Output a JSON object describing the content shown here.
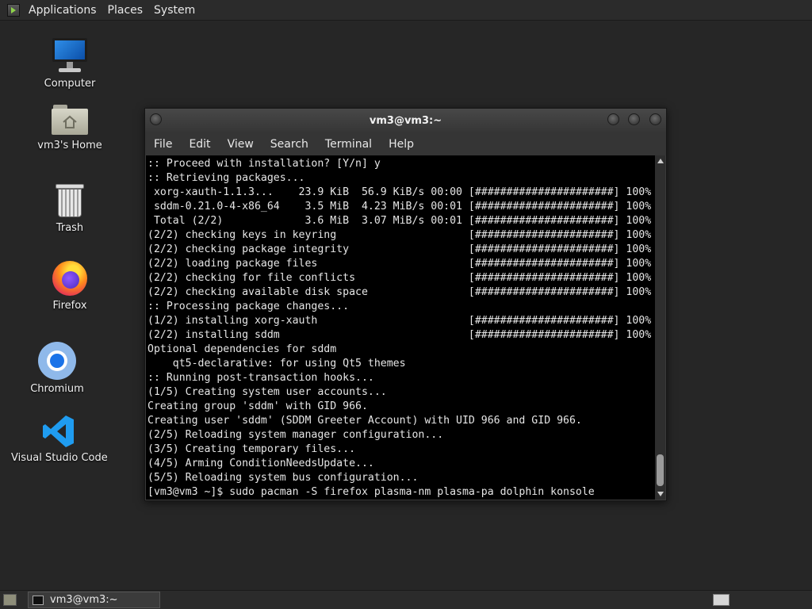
{
  "top_panel": {
    "menus": [
      "Applications",
      "Places",
      "System"
    ]
  },
  "desktop_icons": {
    "computer": "Computer",
    "home": "vm3's Home",
    "trash": "Trash",
    "firefox": "Firefox",
    "chromium": "Chromium",
    "vscode": "Visual Studio Code"
  },
  "terminal": {
    "title": "vm3@vm3:~",
    "menu": [
      "File",
      "Edit",
      "View",
      "Search",
      "Terminal",
      "Help"
    ],
    "lines": [
      ":: Proceed with installation? [Y/n] y",
      ":: Retrieving packages...",
      " xorg-xauth-1.1.3...    23.9 KiB  56.9 KiB/s 00:00 [######################] 100%",
      " sddm-0.21.0-4-x86_64    3.5 MiB  4.23 MiB/s 00:01 [######################] 100%",
      " Total (2/2)             3.6 MiB  3.07 MiB/s 00:01 [######################] 100%",
      "(2/2) checking keys in keyring                     [######################] 100%",
      "(2/2) checking package integrity                   [######################] 100%",
      "(2/2) loading package files                        [######################] 100%",
      "(2/2) checking for file conflicts                  [######################] 100%",
      "(2/2) checking available disk space                [######################] 100%",
      ":: Processing package changes...",
      "(1/2) installing xorg-xauth                        [######################] 100%",
      "(2/2) installing sddm                              [######################] 100%",
      "Optional dependencies for sddm",
      "    qt5-declarative: for using Qt5 themes",
      ":: Running post-transaction hooks...",
      "(1/5) Creating system user accounts...",
      "Creating group 'sddm' with GID 966.",
      "Creating user 'sddm' (SDDM Greeter Account) with UID 966 and GID 966.",
      "(2/5) Reloading system manager configuration...",
      "(3/5) Creating temporary files...",
      "(4/5) Arming ConditionNeedsUpdate...",
      "(5/5) Reloading system bus configuration...",
      "[vm3@vm3 ~]$ sudo pacman -S firefox plasma-nm plasma-pa dolphin konsole"
    ]
  },
  "taskbar": {
    "task_label": "vm3@vm3:~"
  },
  "colors": {
    "desktop_bg": "#262626",
    "terminal_bg": "#000000",
    "terminal_fg": "#e6e6e6",
    "vscode_blue": "#1f9cf0"
  }
}
